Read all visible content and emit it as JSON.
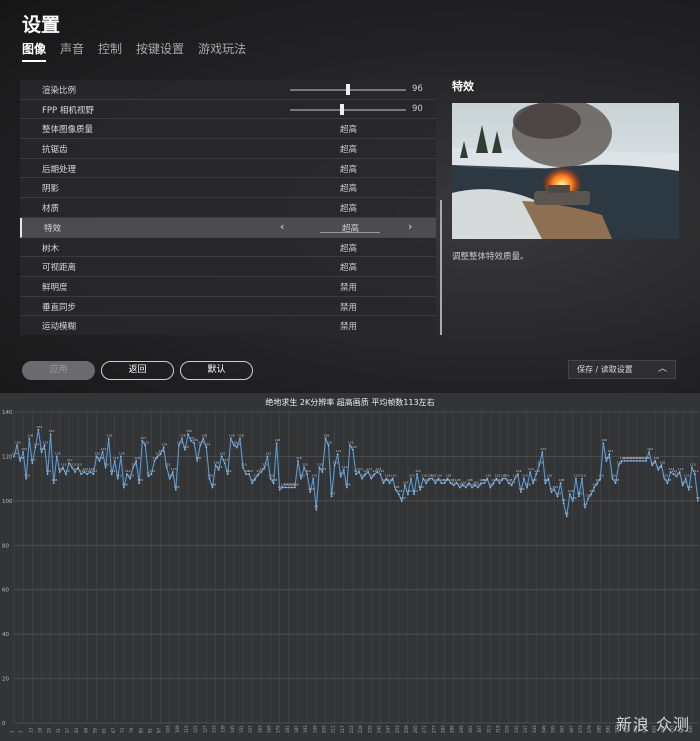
{
  "settings": {
    "title": "设置",
    "tabs": [
      "图像",
      "声音",
      "控制",
      "按键设置",
      "游戏玩法"
    ],
    "rows": [
      {
        "label": "渲染比例",
        "type": "slider",
        "number": "96",
        "level": 0.48
      },
      {
        "label": "FPP 相机视野",
        "type": "slider",
        "number": "90",
        "level": 0.43
      },
      {
        "label": "整体图像质量",
        "value": "超高"
      },
      {
        "label": "抗锯齿",
        "value": "超高"
      },
      {
        "label": "后期处理",
        "value": "超高"
      },
      {
        "label": "阴影",
        "value": "超高"
      },
      {
        "label": "材质",
        "value": "超高"
      },
      {
        "label": "特效",
        "value": "超高",
        "selected": true
      },
      {
        "label": "树木",
        "value": "超高"
      },
      {
        "label": "可视距离",
        "value": "超高"
      },
      {
        "label": "鲜明度",
        "value": "禁用"
      },
      {
        "label": "垂直同步",
        "value": "禁用"
      },
      {
        "label": "运动模糊",
        "value": "禁用"
      }
    ],
    "detail_title": "特效",
    "detail_desc": "调整整体特效质量。",
    "buttons": {
      "apply": "应用",
      "back": "返回",
      "default": "默认"
    },
    "save_load": "保存 / 读取设置"
  },
  "watermark": "新浪 众测",
  "chart_data": {
    "type": "line",
    "title": "绝地求生 2K分辨率 超高画质 平均帧数113左右",
    "ylim": [
      0,
      140
    ],
    "yticks": [
      0,
      20,
      40,
      60,
      80,
      100,
      120,
      140
    ],
    "grid": true,
    "x_start": 1,
    "x_step": 2,
    "values": [
      120,
      125,
      118,
      122,
      110,
      128,
      117,
      124,
      132,
      122,
      125,
      112,
      130,
      108,
      120,
      113,
      115,
      112,
      117,
      115,
      113,
      115,
      112,
      113,
      112,
      113,
      112,
      120,
      118,
      122,
      115,
      128,
      112,
      118,
      110,
      120,
      106,
      112,
      110,
      115,
      118,
      108,
      127,
      125,
      111,
      112,
      118,
      120,
      121,
      124,
      115,
      110,
      113,
      105,
      125,
      128,
      123,
      130,
      127,
      126,
      118,
      125,
      128,
      124,
      110,
      106,
      116,
      114,
      120,
      117,
      112,
      128,
      125,
      124,
      128,
      115,
      112,
      112,
      108,
      110,
      112,
      113,
      115,
      120,
      110,
      108,
      126,
      105,
      106,
      106,
      106,
      106,
      106,
      118,
      110,
      115,
      112,
      104,
      110,
      96,
      115,
      113,
      128,
      125,
      102,
      116,
      121,
      111,
      114,
      106,
      125,
      123,
      112,
      113,
      110,
      112,
      113,
      110,
      112,
      113,
      112,
      108,
      110,
      108,
      110,
      105,
      103,
      100,
      107,
      103,
      110,
      103,
      112,
      105,
      110,
      108,
      110,
      110,
      108,
      110,
      108,
      108,
      110,
      108,
      107,
      108,
      106,
      107,
      106,
      108,
      106,
      107,
      106,
      108,
      108,
      110,
      106,
      108,
      110,
      108,
      110,
      110,
      108,
      107,
      110,
      112,
      104,
      110,
      106,
      113,
      108,
      112,
      116,
      122,
      108,
      110,
      104,
      105,
      102,
      108,
      99,
      93,
      103,
      100,
      110,
      102,
      110,
      97,
      101,
      103,
      106,
      108,
      110,
      126,
      118,
      121,
      110,
      108,
      116,
      118,
      118,
      118,
      118,
      118,
      118,
      118,
      118,
      118,
      122,
      116,
      118,
      114,
      116,
      110,
      108,
      113,
      112,
      111,
      113,
      107,
      110,
      105,
      115,
      112,
      100
    ]
  }
}
